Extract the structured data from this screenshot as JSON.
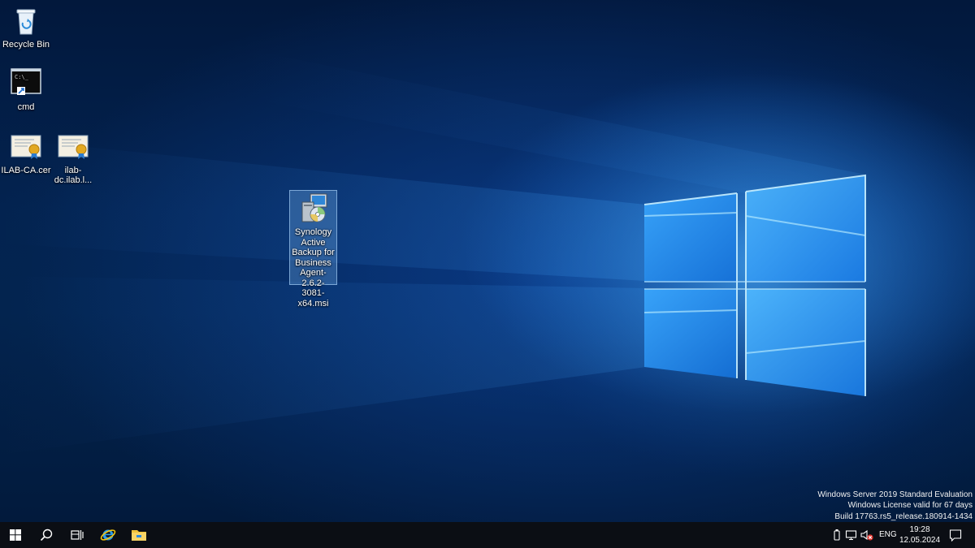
{
  "desktop": {
    "icons": [
      {
        "label": "Recycle Bin"
      },
      {
        "label": "cmd"
      },
      {
        "label": "ILAB-CA.cer"
      },
      {
        "label": "ilab-dc.ilab.l..."
      },
      {
        "label": "Synology Active Backup for Business Agent-2.6.2-3081-x64.msi"
      }
    ]
  },
  "watermark": {
    "line1": "Windows Server 2019 Standard Evaluation",
    "line2": "Windows License valid for 67 days",
    "line3": "Build 17763.rs5_release.180914-1434"
  },
  "taskbar": {
    "start_icon": "windows-logo-icon",
    "search_icon": "search-icon",
    "task_view_icon": "task-view-icon",
    "pinned": [
      "internet-explorer-icon",
      "file-explorer-icon"
    ],
    "tray": {
      "icons": [
        "usb-device-icon",
        "network-icon",
        "volume-muted-icon"
      ],
      "language": "ENG",
      "time": "19:28",
      "date": "12.05.2024"
    }
  },
  "colors": {
    "taskbar": "#0b0e14",
    "accent_light": "#8fd8ff"
  }
}
